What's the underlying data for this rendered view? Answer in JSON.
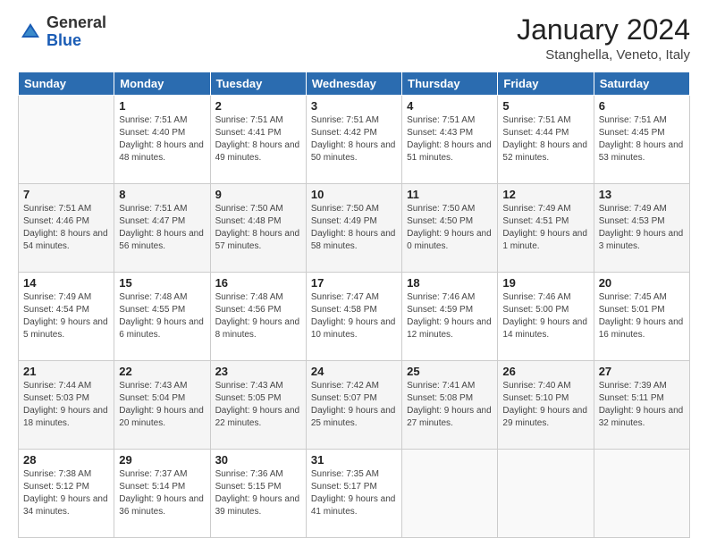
{
  "logo": {
    "general": "General",
    "blue": "Blue"
  },
  "header": {
    "month_title": "January 2024",
    "subtitle": "Stanghella, Veneto, Italy"
  },
  "weekdays": [
    "Sunday",
    "Monday",
    "Tuesday",
    "Wednesday",
    "Thursday",
    "Friday",
    "Saturday"
  ],
  "weeks": [
    [
      {
        "day": "",
        "sunrise": "",
        "sunset": "",
        "daylight": ""
      },
      {
        "day": "1",
        "sunrise": "Sunrise: 7:51 AM",
        "sunset": "Sunset: 4:40 PM",
        "daylight": "Daylight: 8 hours and 48 minutes."
      },
      {
        "day": "2",
        "sunrise": "Sunrise: 7:51 AM",
        "sunset": "Sunset: 4:41 PM",
        "daylight": "Daylight: 8 hours and 49 minutes."
      },
      {
        "day": "3",
        "sunrise": "Sunrise: 7:51 AM",
        "sunset": "Sunset: 4:42 PM",
        "daylight": "Daylight: 8 hours and 50 minutes."
      },
      {
        "day": "4",
        "sunrise": "Sunrise: 7:51 AM",
        "sunset": "Sunset: 4:43 PM",
        "daylight": "Daylight: 8 hours and 51 minutes."
      },
      {
        "day": "5",
        "sunrise": "Sunrise: 7:51 AM",
        "sunset": "Sunset: 4:44 PM",
        "daylight": "Daylight: 8 hours and 52 minutes."
      },
      {
        "day": "6",
        "sunrise": "Sunrise: 7:51 AM",
        "sunset": "Sunset: 4:45 PM",
        "daylight": "Daylight: 8 hours and 53 minutes."
      }
    ],
    [
      {
        "day": "7",
        "sunrise": "Sunrise: 7:51 AM",
        "sunset": "Sunset: 4:46 PM",
        "daylight": "Daylight: 8 hours and 54 minutes."
      },
      {
        "day": "8",
        "sunrise": "Sunrise: 7:51 AM",
        "sunset": "Sunset: 4:47 PM",
        "daylight": "Daylight: 8 hours and 56 minutes."
      },
      {
        "day": "9",
        "sunrise": "Sunrise: 7:50 AM",
        "sunset": "Sunset: 4:48 PM",
        "daylight": "Daylight: 8 hours and 57 minutes."
      },
      {
        "day": "10",
        "sunrise": "Sunrise: 7:50 AM",
        "sunset": "Sunset: 4:49 PM",
        "daylight": "Daylight: 8 hours and 58 minutes."
      },
      {
        "day": "11",
        "sunrise": "Sunrise: 7:50 AM",
        "sunset": "Sunset: 4:50 PM",
        "daylight": "Daylight: 9 hours and 0 minutes."
      },
      {
        "day": "12",
        "sunrise": "Sunrise: 7:49 AM",
        "sunset": "Sunset: 4:51 PM",
        "daylight": "Daylight: 9 hours and 1 minute."
      },
      {
        "day": "13",
        "sunrise": "Sunrise: 7:49 AM",
        "sunset": "Sunset: 4:53 PM",
        "daylight": "Daylight: 9 hours and 3 minutes."
      }
    ],
    [
      {
        "day": "14",
        "sunrise": "Sunrise: 7:49 AM",
        "sunset": "Sunset: 4:54 PM",
        "daylight": "Daylight: 9 hours and 5 minutes."
      },
      {
        "day": "15",
        "sunrise": "Sunrise: 7:48 AM",
        "sunset": "Sunset: 4:55 PM",
        "daylight": "Daylight: 9 hours and 6 minutes."
      },
      {
        "day": "16",
        "sunrise": "Sunrise: 7:48 AM",
        "sunset": "Sunset: 4:56 PM",
        "daylight": "Daylight: 9 hours and 8 minutes."
      },
      {
        "day": "17",
        "sunrise": "Sunrise: 7:47 AM",
        "sunset": "Sunset: 4:58 PM",
        "daylight": "Daylight: 9 hours and 10 minutes."
      },
      {
        "day": "18",
        "sunrise": "Sunrise: 7:46 AM",
        "sunset": "Sunset: 4:59 PM",
        "daylight": "Daylight: 9 hours and 12 minutes."
      },
      {
        "day": "19",
        "sunrise": "Sunrise: 7:46 AM",
        "sunset": "Sunset: 5:00 PM",
        "daylight": "Daylight: 9 hours and 14 minutes."
      },
      {
        "day": "20",
        "sunrise": "Sunrise: 7:45 AM",
        "sunset": "Sunset: 5:01 PM",
        "daylight": "Daylight: 9 hours and 16 minutes."
      }
    ],
    [
      {
        "day": "21",
        "sunrise": "Sunrise: 7:44 AM",
        "sunset": "Sunset: 5:03 PM",
        "daylight": "Daylight: 9 hours and 18 minutes."
      },
      {
        "day": "22",
        "sunrise": "Sunrise: 7:43 AM",
        "sunset": "Sunset: 5:04 PM",
        "daylight": "Daylight: 9 hours and 20 minutes."
      },
      {
        "day": "23",
        "sunrise": "Sunrise: 7:43 AM",
        "sunset": "Sunset: 5:05 PM",
        "daylight": "Daylight: 9 hours and 22 minutes."
      },
      {
        "day": "24",
        "sunrise": "Sunrise: 7:42 AM",
        "sunset": "Sunset: 5:07 PM",
        "daylight": "Daylight: 9 hours and 25 minutes."
      },
      {
        "day": "25",
        "sunrise": "Sunrise: 7:41 AM",
        "sunset": "Sunset: 5:08 PM",
        "daylight": "Daylight: 9 hours and 27 minutes."
      },
      {
        "day": "26",
        "sunrise": "Sunrise: 7:40 AM",
        "sunset": "Sunset: 5:10 PM",
        "daylight": "Daylight: 9 hours and 29 minutes."
      },
      {
        "day": "27",
        "sunrise": "Sunrise: 7:39 AM",
        "sunset": "Sunset: 5:11 PM",
        "daylight": "Daylight: 9 hours and 32 minutes."
      }
    ],
    [
      {
        "day": "28",
        "sunrise": "Sunrise: 7:38 AM",
        "sunset": "Sunset: 5:12 PM",
        "daylight": "Daylight: 9 hours and 34 minutes."
      },
      {
        "day": "29",
        "sunrise": "Sunrise: 7:37 AM",
        "sunset": "Sunset: 5:14 PM",
        "daylight": "Daylight: 9 hours and 36 minutes."
      },
      {
        "day": "30",
        "sunrise": "Sunrise: 7:36 AM",
        "sunset": "Sunset: 5:15 PM",
        "daylight": "Daylight: 9 hours and 39 minutes."
      },
      {
        "day": "31",
        "sunrise": "Sunrise: 7:35 AM",
        "sunset": "Sunset: 5:17 PM",
        "daylight": "Daylight: 9 hours and 41 minutes."
      },
      {
        "day": "",
        "sunrise": "",
        "sunset": "",
        "daylight": ""
      },
      {
        "day": "",
        "sunrise": "",
        "sunset": "",
        "daylight": ""
      },
      {
        "day": "",
        "sunrise": "",
        "sunset": "",
        "daylight": ""
      }
    ]
  ]
}
